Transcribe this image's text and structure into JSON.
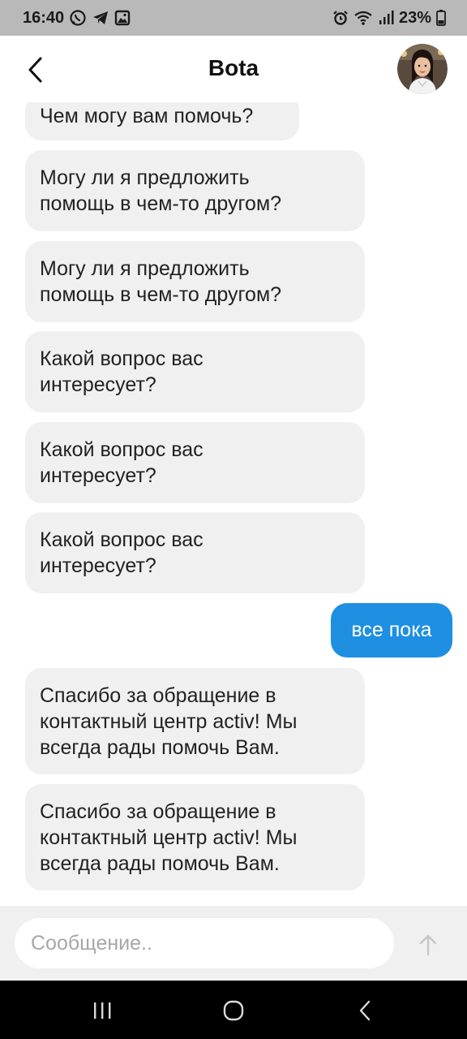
{
  "status_bar": {
    "time": "16:40",
    "battery": "23%",
    "left_icons": [
      "whatsapp-icon",
      "telegram-icon",
      "gallery-icon"
    ],
    "right_icons": [
      "alarm-icon",
      "wifi-icon",
      "signal-icon",
      "battery-icon"
    ]
  },
  "header": {
    "title": "Bota",
    "back_icon": "chevron-left-icon",
    "avatar": "bot-avatar"
  },
  "messages": [
    {
      "sender": "bot",
      "text": "Чем могу вам помочь?"
    },
    {
      "sender": "bot",
      "text": "Могу ли я предложить\nпомощь в чем-то другом?"
    },
    {
      "sender": "bot",
      "text": "Могу ли я предложить\nпомощь в чем-то другом?"
    },
    {
      "sender": "bot",
      "text": "Какой вопрос вас\nинтересует?"
    },
    {
      "sender": "bot",
      "text": "Какой вопрос вас\nинтересует?"
    },
    {
      "sender": "bot",
      "text": "Какой вопрос вас\nинтересует?"
    },
    {
      "sender": "user",
      "text": "все пока"
    },
    {
      "sender": "bot",
      "text": "Спасибо за обращение в\nконтактный центр activ! Мы\nвсегда рады помочь Вам."
    },
    {
      "sender": "bot",
      "text": "Спасибо за обращение в\nконтактный центр activ! Мы\nвсегда рады помочь Вам."
    }
  ],
  "composer": {
    "value": "",
    "placeholder": "Сообщение..",
    "send_icon": "arrow-up-icon"
  },
  "nav_bar": {
    "buttons": [
      "recent-apps",
      "home",
      "back"
    ]
  },
  "colors": {
    "user_bubble": "#1e8fe1",
    "bot_bubble": "#f0f0f0",
    "status_bar": "#b9b9b9"
  }
}
